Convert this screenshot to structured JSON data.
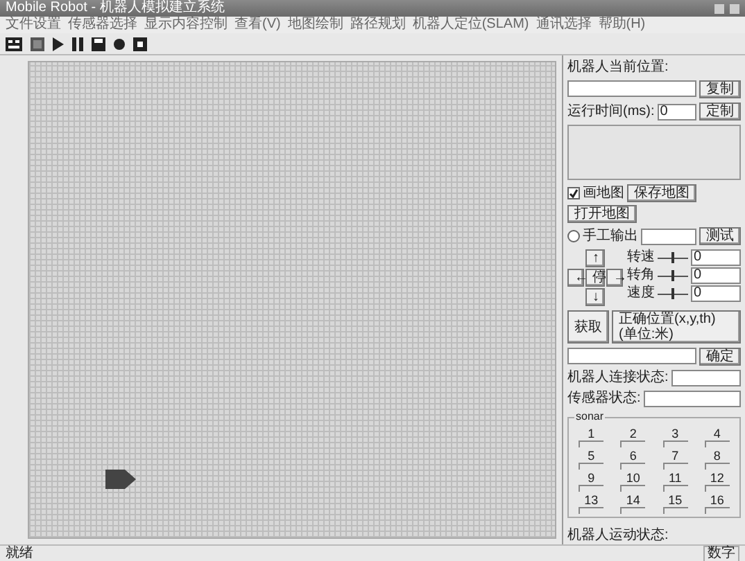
{
  "window": {
    "title": "Mobile Robot - 机器人模拟建立系统"
  },
  "menu": [
    "文件设置",
    "传感器选择",
    "显示内容控制",
    "查看(V)",
    "地图绘制",
    "路径规划",
    "机器人定位(SLAM)",
    "通讯选择",
    "帮助(H)"
  ],
  "panel": {
    "position_label": "机器人当前位置:",
    "position_button": "复制",
    "runtime_label": "运行时间(ms):",
    "runtime_value": "0",
    "runtime_button": "定制",
    "draw_map": {
      "label": "画地图",
      "checked": true
    },
    "save_map": "保存地图",
    "open_map": "打开地图",
    "manual": {
      "label": "手工输出",
      "checked": false
    },
    "test_button": "测试",
    "pad": {
      "up": "↑",
      "down": "↓",
      "left": "←",
      "right": "→",
      "center": "停"
    },
    "sliders": [
      {
        "label": "转速",
        "level": 0.5,
        "value": "0"
      },
      {
        "label": "转角",
        "level": 0.5,
        "value": "0"
      },
      {
        "label": "速度",
        "level": 0.5,
        "value": "0"
      }
    ],
    "get_button": "获取",
    "correct_button": "正确位置(x,y,th)(单位:米)",
    "ok_button": "确定",
    "connection_label": "机器人连接状态:",
    "sensor_label": "传感器状态:",
    "sonar": {
      "title": "sonar",
      "items": [
        "1",
        "2",
        "3",
        "4",
        "5",
        "6",
        "7",
        "8",
        "9",
        "10",
        "11",
        "12",
        "13",
        "14",
        "15",
        "16"
      ]
    },
    "motion_label": "机器人运动状态:"
  },
  "status_bar": {
    "left": "就绪",
    "right": "数字"
  }
}
